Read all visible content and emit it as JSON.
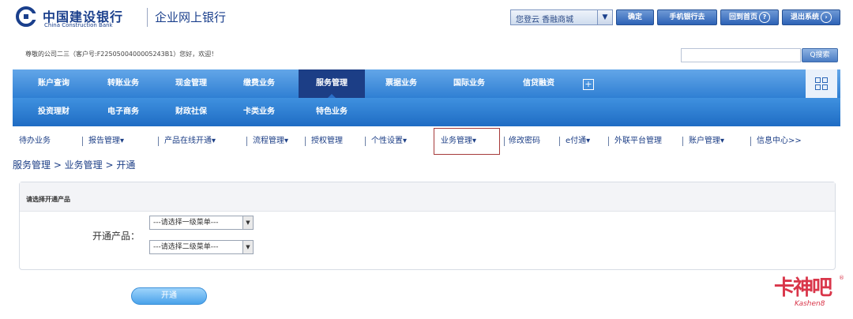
{
  "header": {
    "brand_cn": "中国建设银行",
    "brand_en": "China Construction Bank",
    "site_title": "企业网上银行",
    "select_value": "您登云 香融商城",
    "buttons": [
      {
        "label": "确定"
      },
      {
        "label": "手机银行去"
      },
      {
        "label": "回到首页",
        "icon": "help-icon",
        "glyph": "?"
      },
      {
        "label": "退出系统",
        "icon": "exit-icon",
        "glyph": "›"
      }
    ]
  },
  "welcome": {
    "text": "尊敬的公司二三（客户号:F2250500400005243B1）您好，欢迎！",
    "search_placeholder": "",
    "search_label": "Q搜索"
  },
  "nav_primary": [
    {
      "label": "账户查询"
    },
    {
      "label": "转账业务"
    },
    {
      "label": "现金管理"
    },
    {
      "label": "缴费业务"
    },
    {
      "label": "服务管理",
      "active": true
    },
    {
      "label": "票据业务"
    },
    {
      "label": "国际业务"
    },
    {
      "label": "信贷融资"
    }
  ],
  "nav_secondary": [
    {
      "label": "投资理财"
    },
    {
      "label": "电子商务"
    },
    {
      "label": "财政社保"
    },
    {
      "label": "卡类业务"
    },
    {
      "label": "特色业务"
    }
  ],
  "sub_nav": [
    {
      "label": "待办业务"
    },
    {
      "label": "报告管理▾"
    },
    {
      "label": "产品在线开通▾"
    },
    {
      "label": "流程管理▾"
    },
    {
      "label": "授权管理"
    },
    {
      "label": "个性设置▾"
    },
    {
      "label": "业务管理▾",
      "active": true
    },
    {
      "label": "修改密码"
    },
    {
      "label": "e付通▾"
    },
    {
      "label": "外联平台管理"
    },
    {
      "label": "账户管理▾"
    },
    {
      "label": "信息中心>>"
    }
  ],
  "breadcrumb": "服务管理 > 业务管理 > 开通",
  "panel": {
    "title": "请选择开通产品",
    "form_label": "开通产品：",
    "dropdown1": "---请选择一级菜单---",
    "dropdown2": "---请选择二级菜单---"
  },
  "submit_label": "开通",
  "watermark": {
    "main": "卡神吧",
    "sub": "Kashen8",
    "reg": "®"
  },
  "colors": {
    "nav_primary": "#3a8ce0",
    "nav_active": "#1c3e86",
    "brand": "#1a3f8c",
    "watermark": "#d9364a"
  }
}
